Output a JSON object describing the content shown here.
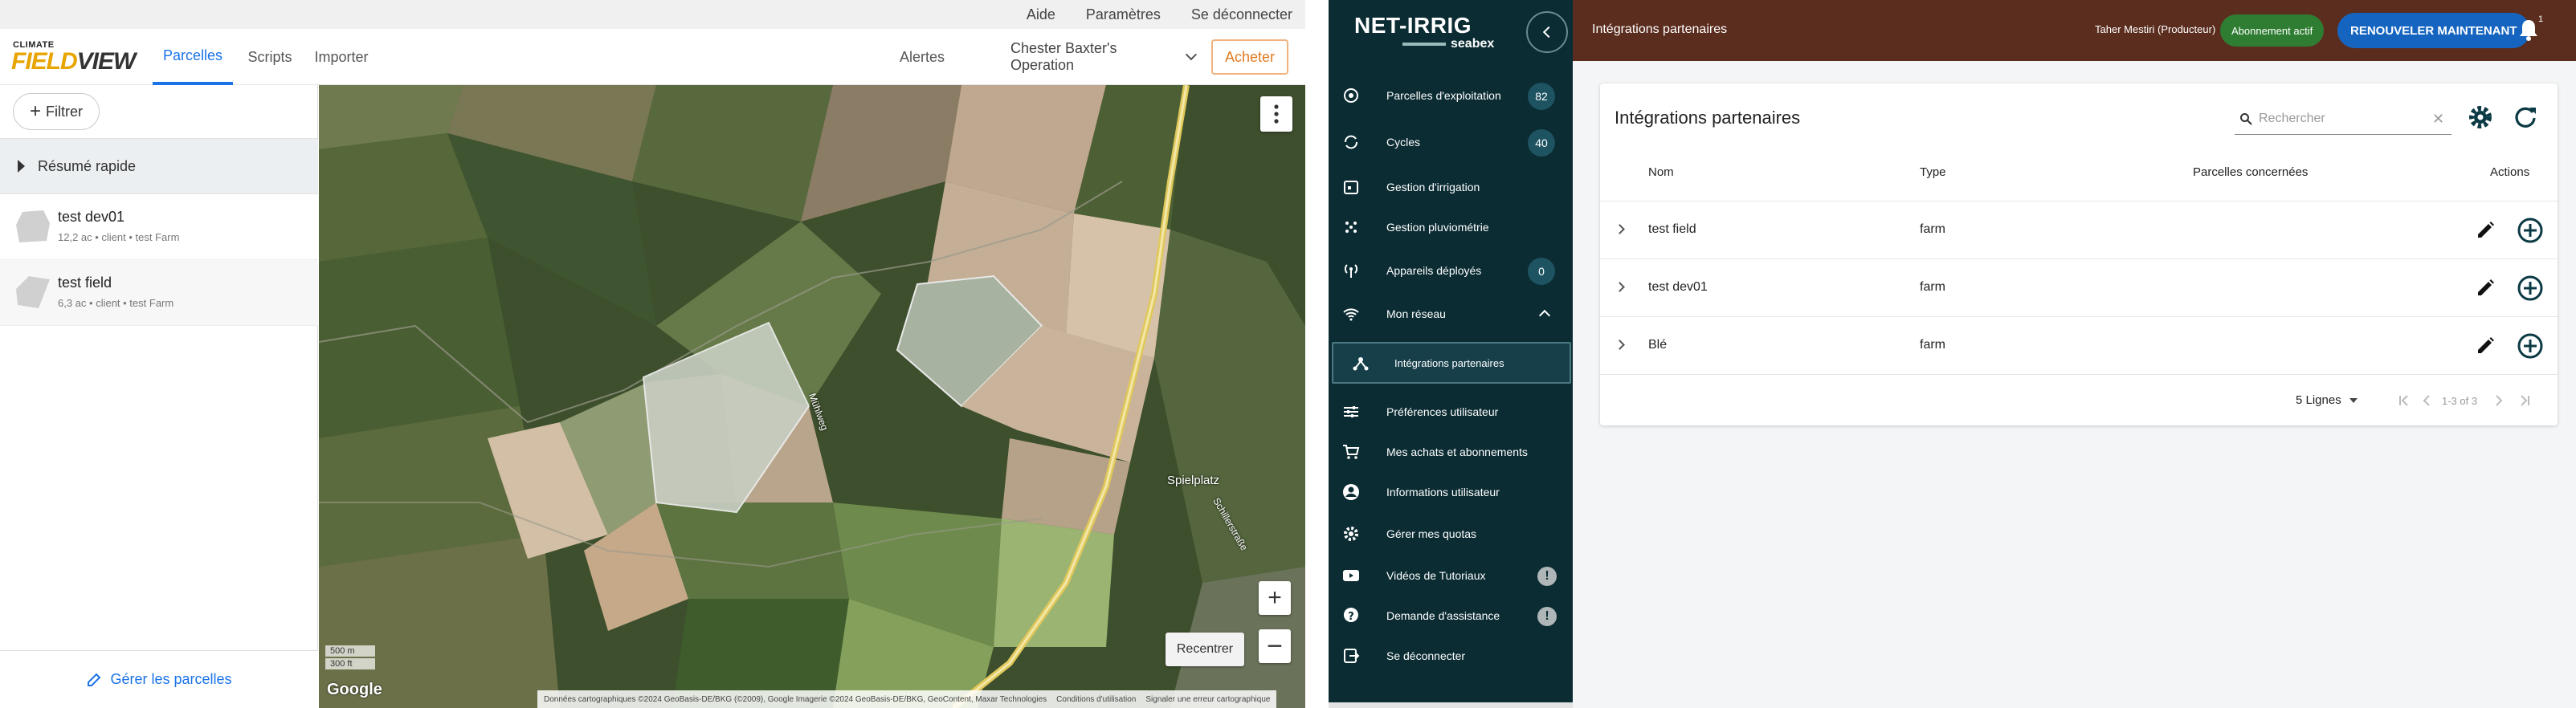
{
  "fieldview": {
    "util_links": [
      "Aide",
      "Paramètres",
      "Se déconnecter"
    ],
    "logo": {
      "small": "CLIMATE",
      "big_a": "FIELD",
      "big_b": "VIEW"
    },
    "nav": {
      "parcelles": "Parcelles",
      "scripts": "Scripts",
      "importer": "Importer",
      "alertes": "Alertes",
      "operation": "Chester Baxter's Operation"
    },
    "acheter": "Acheter",
    "filter_label": "Filtrer",
    "resume_label": "Résumé rapide",
    "fields": [
      {
        "name": "test dev01",
        "meta": "12,2 ac • client • test Farm"
      },
      {
        "name": "test field",
        "meta": "6,3 ac • client • test Farm"
      }
    ],
    "manage_label": "Gérer les parcelles",
    "map": {
      "recentrer": "Recentrer",
      "scale_m": "500 m",
      "scale_ft": "300 ft",
      "google": "Google",
      "attribution": [
        "Données cartographiques ©2024 GeoBasis-DE/BKG (©2009), Google Imagerie ©2024 GeoBasis-DE/BKG, GeoContent, Maxar Technologies",
        "Conditions d'utilisation",
        "Signaler une erreur cartographique"
      ],
      "labels": [
        "Spielplatz",
        "Schillerstraße",
        "Mühlweg"
      ]
    }
  },
  "netirrig": {
    "logo_main": "NET-IRRIG",
    "logo_sub": "seabex",
    "menu": [
      {
        "label": "Parcelles d'exploitation",
        "icon": "target-icon",
        "count": "82"
      },
      {
        "label": "Cycles",
        "icon": "cycle-icon",
        "count": "40"
      },
      {
        "label": "Gestion d'irrigation",
        "icon": "calendar-icon"
      },
      {
        "label": "Gestion pluviométrie",
        "icon": "rain-icon"
      },
      {
        "label": "Appareils déployés",
        "icon": "antenna-icon",
        "count": "0"
      },
      {
        "label": "Mon réseau",
        "icon": "wifi-icon"
      },
      {
        "label": "Intégrations partenaires",
        "icon": "hub-icon"
      },
      {
        "label": "Préférences utilisateur",
        "icon": "sliders-icon"
      },
      {
        "label": "Mes achats et abonnements",
        "icon": "cart-icon"
      },
      {
        "label": "Informations utilisateur",
        "icon": "account-icon"
      },
      {
        "label": "Gérer mes quotas",
        "icon": "gear-icon"
      },
      {
        "label": "Vidéos de Tutoriaux",
        "icon": "video-icon",
        "excl": "!"
      },
      {
        "label": "Demande d'assistance",
        "icon": "help-icon",
        "excl": "!"
      },
      {
        "label": "Se déconnecter",
        "icon": "logout-icon"
      }
    ],
    "topbar": {
      "title": "Intégrations partenaires",
      "user": "Taher Mestiri (Producteur)",
      "badge": "Abonnement actif",
      "renew": "RENOUVELER MAINTENANT",
      "bell_count": "1"
    },
    "card": {
      "title": "Intégrations partenaires",
      "search_placeholder": "Rechercher",
      "columns": [
        "Nom",
        "Type",
        "Parcelles concernées",
        "Actions"
      ],
      "rows": [
        {
          "nom": "test field",
          "type": "farm"
        },
        {
          "nom": "test dev01",
          "type": "farm"
        },
        {
          "nom": "Blé",
          "type": "farm"
        }
      ],
      "pager": {
        "rows_label": "5 Lignes",
        "range": "1-3 of 3"
      }
    }
  },
  "colors": {
    "fv_blue": "#1a73e8",
    "fv_orange": "#e07a1f",
    "ni_sidebar": "#0b2c33",
    "ni_topbar": "#5b2d1f",
    "ni_badge": "#2f7d32",
    "ni_renew": "#1565c0"
  }
}
